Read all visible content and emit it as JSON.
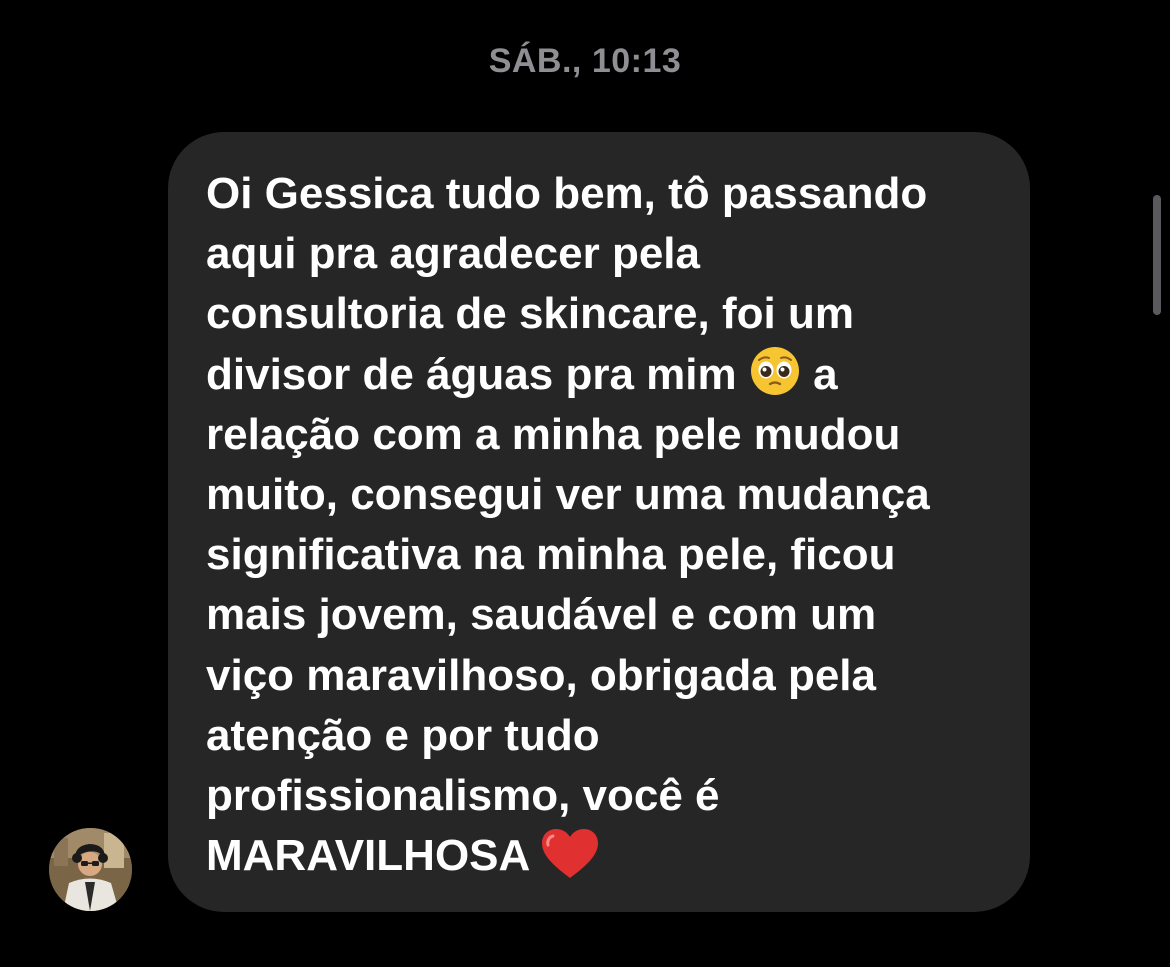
{
  "conversation": {
    "timestamp": "SÁB., 10:13"
  },
  "message": {
    "sender": "incoming",
    "lines": [
      "Oi Gessica tudo bem, tô passando",
      "aqui pra agradecer pela",
      "consultoria de skincare, foi um",
      "divisor de águas pra mim",
      "a",
      "relação com a minha pele mudou",
      "muito, consegui ver uma mudança",
      "significativa na minha pele, ficou",
      "mais jovem, saudável e com um",
      "viço maravilhoso, obrigada pela",
      "atenção e por tudo",
      "profissionalismo, você é",
      "MARAVILHOSA"
    ],
    "bubble_color": "#262626",
    "text_color": "#ffffff"
  },
  "icons": {
    "pleading_face": "pleading-face-emoji",
    "heart": "red-heart-emoji",
    "avatar": "sender-avatar"
  },
  "colors": {
    "background": "#000000",
    "timestamp": "#8e8e93"
  }
}
